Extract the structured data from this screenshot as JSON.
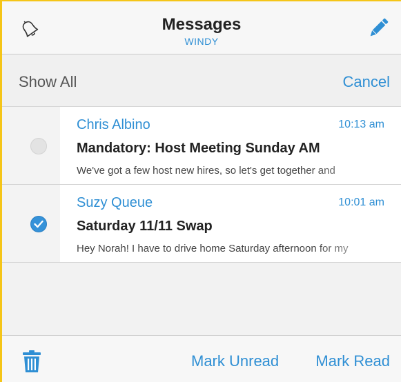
{
  "header": {
    "title": "Messages",
    "subtitle": "WINDY",
    "left_icon": "bell-icon",
    "right_icon": "pencil-icon"
  },
  "toolbar": {
    "show_all_label": "Show All",
    "cancel_label": "Cancel"
  },
  "messages": [
    {
      "sender": "Chris Albino",
      "time": "10:13 am",
      "subject": "Mandatory: Host Meeting Sunday AM",
      "preview": "We've got a few host new hires, so let's get together and",
      "selected": false
    },
    {
      "sender": "Suzy Queue",
      "time": "10:01 am",
      "subject": "Saturday 11/11 Swap",
      "preview": "Hey Norah! I have to drive home Saturday afternoon for my",
      "selected": true
    }
  ],
  "bottom_bar": {
    "delete_icon": "trash-icon",
    "mark_unread_label": "Mark Unread",
    "mark_read_label": "Mark Read"
  },
  "colors": {
    "accent": "#2f8fd4",
    "selected_radio": "#3592d9",
    "frame_border": "#f5c518"
  }
}
